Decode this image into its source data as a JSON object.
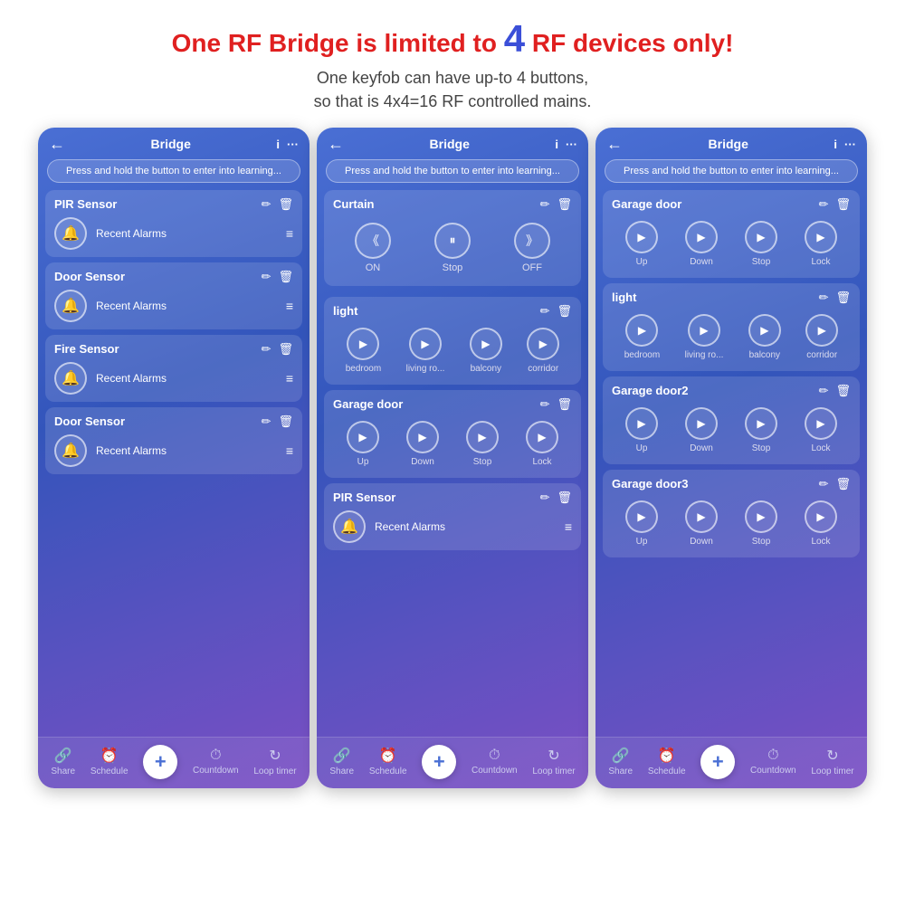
{
  "header": {
    "line1a": "One RF Bridge is limited to ",
    "line1num": "4",
    "line1b": " RF devices only!",
    "line2a": "One keyfob can have up-to 4 buttons,",
    "line2b": "so that is 4x4=16 RF controlled mains."
  },
  "screens": [
    {
      "id": "screen1",
      "title": "Bridge",
      "learn_btn": "Press and hold the button to enter into learning...",
      "devices": [
        {
          "name": "PIR Sensor",
          "type": "alarm"
        },
        {
          "name": "Door Sensor",
          "type": "alarm"
        },
        {
          "name": "Fire Sensor",
          "type": "alarm"
        },
        {
          "name": "Door Sensor",
          "type": "alarm"
        }
      ],
      "footer": [
        "Share",
        "Schedule",
        "+",
        "Countdown",
        "Loop timer"
      ]
    },
    {
      "id": "screen2",
      "title": "Bridge",
      "learn_btn": "Press and hold the button to enter into learning...",
      "sections": [
        {
          "name": "Curtain",
          "type": "curtain",
          "buttons": [
            "ON",
            "Stop",
            "OFF"
          ]
        },
        {
          "name": "light",
          "type": "light4",
          "buttons": [
            "bedroom",
            "living ro...",
            "balcony",
            "corridor"
          ]
        },
        {
          "name": "Garage door",
          "type": "garage4",
          "buttons": [
            "Up",
            "Down",
            "Stop",
            "Lock"
          ]
        },
        {
          "name": "PIR Sensor",
          "type": "pir"
        }
      ],
      "footer": [
        "Share",
        "Schedule",
        "+",
        "Countdown",
        "Loop timer"
      ]
    },
    {
      "id": "screen3",
      "title": "Bridge",
      "learn_btn": "Press and hold the button to enter into learning...",
      "sections": [
        {
          "name": "Garage door",
          "type": "garage4",
          "buttons": [
            "Up",
            "Down",
            "Stop",
            "Lock"
          ]
        },
        {
          "name": "light",
          "type": "light4",
          "buttons": [
            "bedroom",
            "living ro...",
            "balcony",
            "corridor"
          ]
        },
        {
          "name": "Garage door2",
          "type": "garage4",
          "buttons": [
            "Up",
            "Down",
            "Stop",
            "Lock"
          ]
        },
        {
          "name": "Garage door3",
          "type": "garage4",
          "buttons": [
            "Up",
            "Down",
            "Stop",
            "Lock"
          ]
        }
      ],
      "footer": [
        "Share",
        "Schedule",
        "+",
        "Countdown",
        "Loop timer"
      ]
    }
  ],
  "icons": {
    "back": "←",
    "info": "i",
    "more": "···",
    "bell": "🔔",
    "edit": "✏",
    "delete": "🗑",
    "list": "≡",
    "share": "🔗",
    "schedule": "⏰",
    "plus": "+",
    "countdown": "⏱",
    "loop": "↻",
    "play": "▶",
    "expand_left": "《",
    "pause": "⏸",
    "expand_right": "》"
  }
}
